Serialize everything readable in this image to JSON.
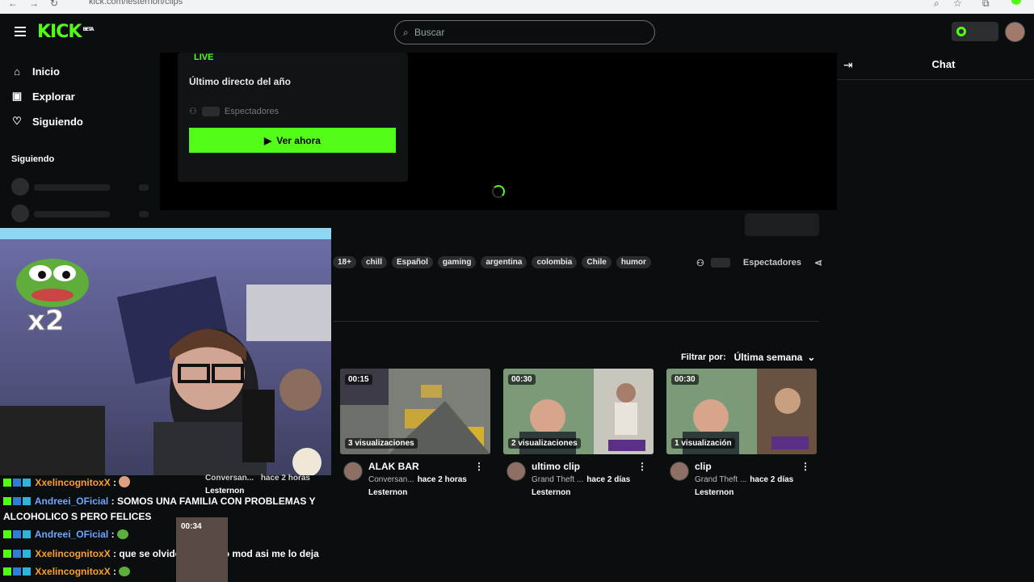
{
  "browser": {
    "url": "kick.com/lesternon/clips"
  },
  "header": {
    "logo": "KICK",
    "logo_badge": "BETA",
    "search_placeholder": "Buscar"
  },
  "sidebar": {
    "items": [
      {
        "label": "Inicio",
        "icon": "home-icon"
      },
      {
        "label": "Explorar",
        "icon": "compass-icon"
      },
      {
        "label": "Siguiendo",
        "icon": "heart-icon"
      }
    ],
    "heading": "Siguiendo"
  },
  "live": {
    "badge": "LIVE",
    "title": "Último directo del año",
    "viewers_label": "Espectadores",
    "watch_button": "Ver ahora"
  },
  "chat": {
    "title": "Chat"
  },
  "channel": {
    "tags": [
      "18+",
      "chill",
      "Español",
      "gaming",
      "argentina",
      "colombia",
      "Chile",
      "humor"
    ],
    "viewers_label": "Espectadores"
  },
  "clips": {
    "filter_label": "Filtrar por:",
    "filter_value": "Última semana",
    "items": [
      {
        "duration": "00:15",
        "views": "3 visualizaciones",
        "title": "ALAK BAR",
        "category": "Conversan...",
        "age": "hace 2 horas",
        "channel": "Lesternon"
      },
      {
        "duration": "00:30",
        "views": "2 visualizaciones",
        "title": "ultimo clip",
        "category": "Grand Theft ...",
        "age": "hace 2 días",
        "channel": "Lesternon"
      },
      {
        "duration": "00:30",
        "views": "1 visualización",
        "title": "clip",
        "category": "Grand Theft ...",
        "age": "hace 2 días",
        "channel": "Lesternon"
      }
    ],
    "hidden_row": {
      "duration": "00:34",
      "category": "Conversan...",
      "age": "hace 2 horas",
      "channel": "Lesternon"
    }
  },
  "stream_overlay": {
    "multiplier": "x2",
    "messages": [
      {
        "user": "XxelincognitoxX",
        "text": ":",
        "color": "orange"
      },
      {
        "user": "Andreei_OFicial",
        "text": ": SOMOS UNA FAMILIA CON PROBLEMAS Y ALCOHOLICO S PERO FELICES",
        "color": "blue"
      },
      {
        "user": "Andreei_OFicial",
        "text": ":",
        "color": "blue"
      },
      {
        "user": "XxelincognitoxX",
        "text": ": que se olvide que tengo mod asi me lo deja",
        "color": "orange"
      },
      {
        "user": "XxelincognitoxX",
        "text": ":",
        "color": "orange"
      }
    ]
  }
}
